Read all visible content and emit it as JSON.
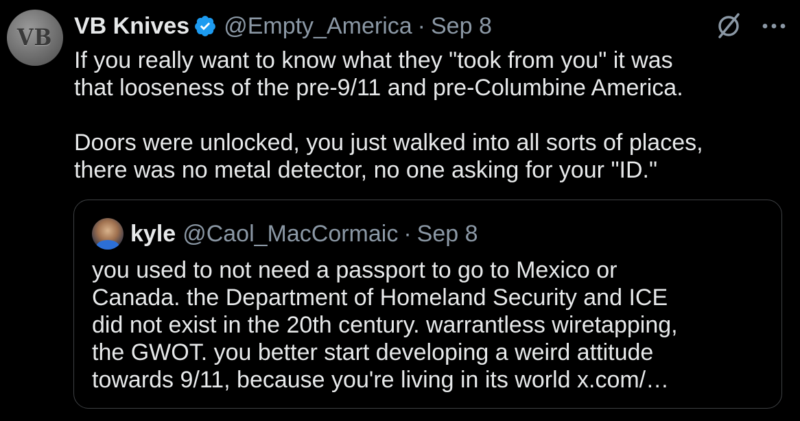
{
  "tweet": {
    "avatar_text": "VB",
    "display_name": "VB Knives",
    "handle": "@Empty_America",
    "separator": "·",
    "date": "Sep 8",
    "text": "If you really want to know what they \"took from you\" it was\nthat looseness of the pre-9/11 and pre-Columbine America.\n\nDoors were unlocked, you just walked into all sorts of places,\nthere was no metal detector, no one asking for your \"ID.\"",
    "icons": {
      "verified": "verified-badge-icon",
      "block": "block-icon",
      "more": "more-icon"
    },
    "colors": {
      "background": "#000000",
      "text": "#e7e9ea",
      "muted": "#8b98a5",
      "verified": "#1d9bf0",
      "border": "#3e4144"
    }
  },
  "quote": {
    "display_name": "kyle",
    "handle": "@Caol_MacCormaic",
    "separator": "·",
    "date": "Sep 8",
    "text": "you used to not need a passport to go to Mexico or\nCanada. the Department of Homeland Security and ICE\ndid not exist in the 20th century. warrantless wiretapping,\nthe GWOT. you better start developing a weird attitude\ntowards 9/11, because you're living in its world x.com/…"
  }
}
